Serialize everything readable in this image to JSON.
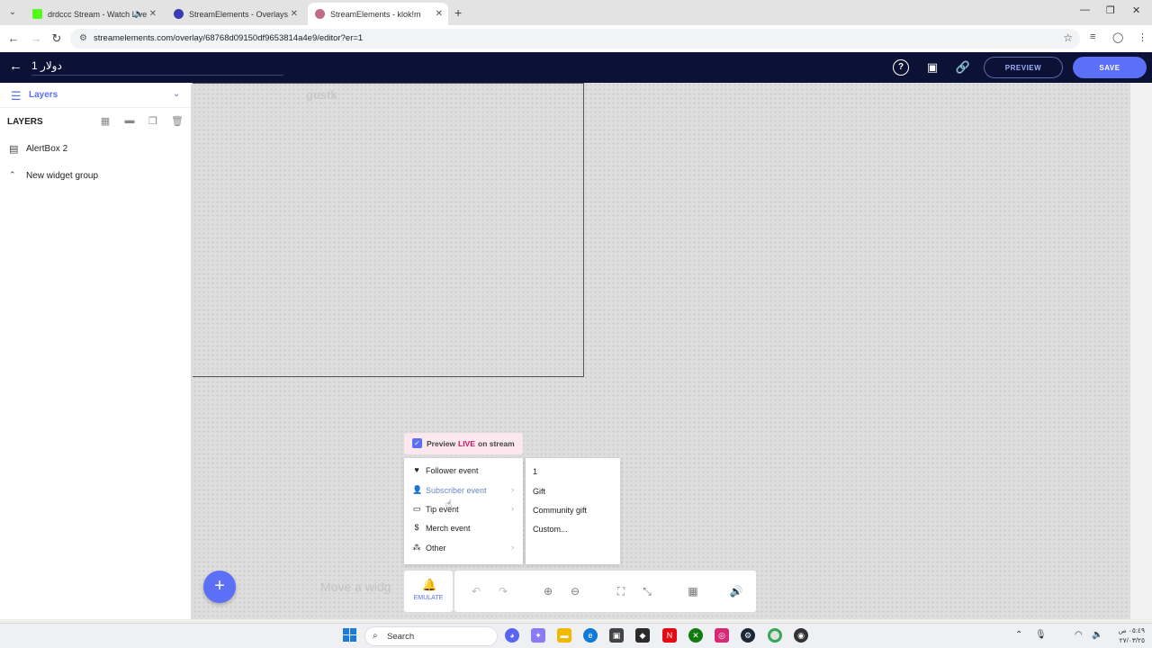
{
  "browser": {
    "tabs": [
      {
        "title": "drdccc Stream - Watch Live",
        "favicon_color": "#53fc18"
      },
      {
        "title": "StreamElements - Overlays",
        "favicon_color": "#3b3bb5"
      },
      {
        "title": "StreamElements - klok!m",
        "favicon_color": "#c06c84"
      }
    ],
    "url": "streamelements.com/overlay/68768d09150df9653814a4e9/editor?er=1"
  },
  "header": {
    "overlay_name": "دولار 1",
    "preview_label": "PREVIEW",
    "save_label": "SAVE"
  },
  "left_panel": {
    "section_label": "Layers",
    "layers_title": "LAYERS",
    "layers": [
      {
        "name": "AlertBox 2"
      },
      {
        "name": "New widget group"
      }
    ]
  },
  "canvas": {
    "widget_ghost_text": "gustk",
    "move_hint": "Move a widg"
  },
  "emulate": {
    "badge_prefix": "Preview",
    "badge_live": "LIVE",
    "badge_suffix": "on stream",
    "menu_items": [
      {
        "label": "Follower event",
        "icon": "heart-icon"
      },
      {
        "label": "Subscriber event",
        "icon": "subscriber-icon"
      },
      {
        "label": "Tip event",
        "icon": "card-icon"
      },
      {
        "label": "Merch event",
        "icon": "dollar-icon"
      },
      {
        "label": "Other",
        "icon": "shapes-icon"
      }
    ],
    "submenu_items": [
      "1",
      "Gift",
      "Community gift",
      "Custom..."
    ],
    "button_label": "EMULATE"
  },
  "taskbar": {
    "search_label": "Search",
    "time": "٠٥:٤٩ ص",
    "date": "٢٧/٠٣/٢٥"
  },
  "colors": {
    "accent": "#5b6ff7",
    "header_bg": "#0b1236",
    "live_red": "#d1105a"
  }
}
